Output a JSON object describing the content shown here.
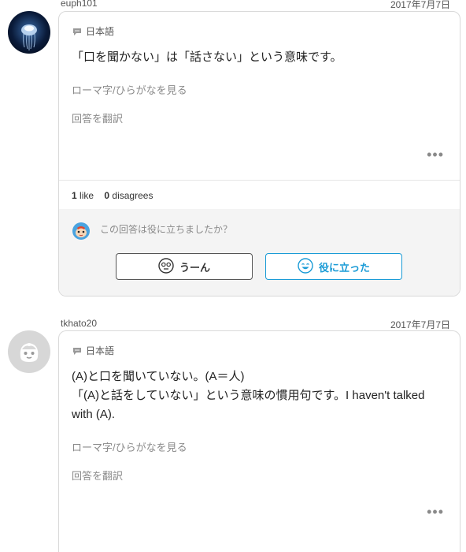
{
  "answers": [
    {
      "username": "euph101",
      "date": "2017年7月7日",
      "language": "日本語",
      "text_lines": [
        "「口を聞かない」は「話さない」という意味です。"
      ],
      "romaji_link": "ローマ字/ひらがなを見る",
      "translate_link": "回答を翻訳",
      "more": "•••",
      "likes_count": "1",
      "likes_label": "like",
      "disagrees_count": "0",
      "disagrees_label": "disagrees",
      "helpful_question": "この回答は役に立ちましたか？",
      "hmm_label": "うーん",
      "helpful_label": "役に立った"
    },
    {
      "username": "tkhato20",
      "date": "2017年7月7日",
      "language": "日本語",
      "text_lines": [
        "(A)と口を聞いていない。(A＝人)",
        "「(A)と話をしていない」という意味の慣用句です。I haven't talked",
        "with (A)."
      ],
      "romaji_link": "ローマ字/ひらがなを見る",
      "translate_link": "回答を翻訳",
      "more": "•••"
    }
  ],
  "colors": {
    "accent": "#1a9bd6",
    "border": "#d9d9d9",
    "muted_text": "#8a8a8a"
  },
  "icons": [
    "chat-bubble-icon",
    "jellyfish-avatar",
    "default-avatar-icon",
    "mascot-icon",
    "hmm-face-icon",
    "smile-face-icon",
    "more-dots-icon"
  ]
}
